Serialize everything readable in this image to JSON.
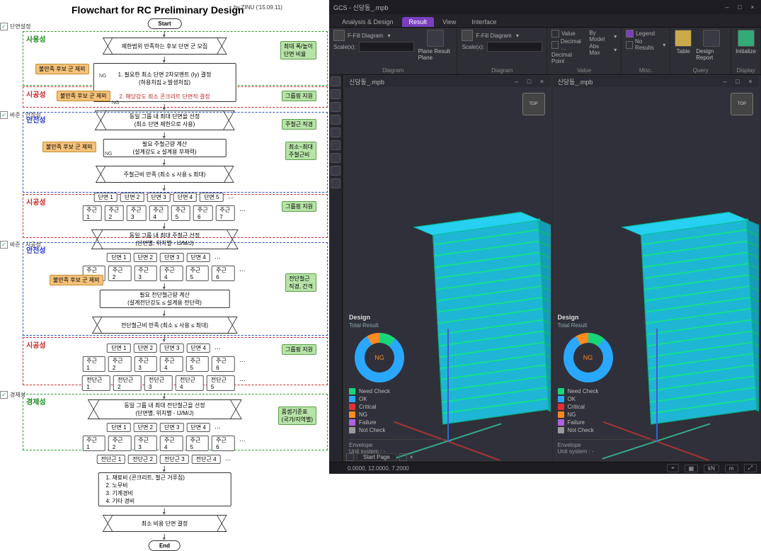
{
  "flowchart": {
    "title": "Flowchart for RC Preliminary Design",
    "byline": "by ZINU ('15.09.11)",
    "checkboxes": [
      "단면설정",
      "바준 - 안정성",
      "바준 - 시공성",
      "경제성"
    ],
    "terminators": {
      "start": "Start",
      "end": "End"
    },
    "zones": {
      "z1": "사용성",
      "z2": "시공성",
      "z3": "안전성",
      "z4": "시공성",
      "z5": "안전성",
      "z6": "시공성",
      "z7": "경제성"
    },
    "nodes": {
      "n1": "제한범위 만족하는 후보 단면 군 모집",
      "n2_line1": "1. 필요한 최소 단면 2차모멘트 (Iy) 결정\n(허용처짐 ≥ 발생처짐)",
      "n2_line2": "2. 해당강도 최소 콘크리트 단면적 결정",
      "n3": "동일 그룹 내 최대 단면을 선정\n(최소 단면 제한으로 사용)",
      "n4": "필요 주철근량 계산\n(설계강도 ≥ 설계용 부재력)",
      "n5": "주철근비 만족 (최소 ≤ 사용 ≤ 최대)",
      "n6": "동일 그룹 내 최대 주철근 선정\n(단면별, 위치별 - IJ/M/J)",
      "n7": "필요 전단철근량 계산\n(설계전단강도 ≤ 설계용 전단력)",
      "n8": "전단철근비 만족 (최소 ≤ 사용 ≤ 최대)",
      "n9": "동일 그룹 내 최대 전단철근을 선정\n(단면별, 위치별 - IJ/M/J)",
      "n10": "1. 재료비 (콘크리트, 철근 거푸집)\n2. 노무비\n3. 기계경비\n4. 기타 경비",
      "n11": "최소 비용 단면 결정"
    },
    "ng_label": "NG",
    "sides": {
      "s1": "최대 폭/높이\n단면 비율",
      "s2": "그룹핑 지원",
      "s3": "주철근 직경",
      "s4": "최소~최대\n주철근비",
      "s5": "그룹핑 지원",
      "s6": "전단철근\n직경, 간격",
      "s7": "그룹핑 지원",
      "s8": "품셈기준표\n(국가/지역별)",
      "o1": "불만족 후보 군 제외",
      "o2": "불만족 후보 군 제외",
      "o3": "불만족 후보 군 제외",
      "o4": "불만족 후보 군 제외"
    },
    "rows": {
      "section": [
        "단면 1",
        "단면 2",
        "단면 3",
        "단면 4",
        "단면 5"
      ],
      "rebar": [
        "주근 1",
        "주근 2",
        "주근 3",
        "주근 4",
        "주근 5",
        "주근 6",
        "주근 7"
      ],
      "sec4": [
        "단면 1",
        "단면 2",
        "단면 3",
        "단면 4"
      ],
      "reb6": [
        "주근 1",
        "주근 2",
        "주근 3",
        "주근 4",
        "주근 5",
        "주근 6"
      ],
      "shear": [
        "전단근 1",
        "전단근 2",
        "전단근 3",
        "전단근 4",
        "전단근 5"
      ]
    }
  },
  "app": {
    "title": "GCS - 신당동_.mpb",
    "tabs": [
      "Analysis & Design",
      "Result",
      "View",
      "Interface"
    ],
    "ribbon": {
      "diagram": {
        "btn1": "F-Fill Diagram",
        "scale": "Scale(x):",
        "plane": "Plane\nResult\nPlane",
        "label": "Diagram"
      },
      "diagram2": {
        "btn1": "F-Fill Diagram",
        "scale": "Scale(x):",
        "label": "Diagram"
      },
      "value": {
        "v1": "Value",
        "v2": "Decimal …",
        "v3": "Decimal Point",
        "by1": "By Model",
        "by2": "Abs Max",
        "label": "Value"
      },
      "misc": {
        "legend": "Legend",
        "noresults": "No Results",
        "label": "Misc."
      },
      "query": {
        "table": "Table",
        "report": "Design\nReport",
        "label": "Query"
      },
      "display": {
        "init": "Initialize",
        "label": "Display"
      }
    },
    "pane_title": "신당동_.mpb",
    "cube": "TOP",
    "design": {
      "heading": "Design",
      "sub": "Total Result",
      "center": "NG",
      "legend": [
        {
          "label": "Need Check",
          "color": "#17d67a"
        },
        {
          "label": "OK",
          "color": "#2aa8ff"
        },
        {
          "label": "Critical",
          "color": "#e03030"
        },
        {
          "label": "NG",
          "color": "#ff8b1f"
        },
        {
          "label": "Failure",
          "color": "#b060e0"
        },
        {
          "label": "Not Check",
          "color": "#9a9a9a"
        }
      ],
      "envelope": "Envelope",
      "unit": "Unit system : -"
    },
    "bottom_tab": "Start Page",
    "status": {
      "coords": "0.0000, 12.0000, 7.2000",
      "units_len": "m",
      "units_force": "kN"
    }
  }
}
